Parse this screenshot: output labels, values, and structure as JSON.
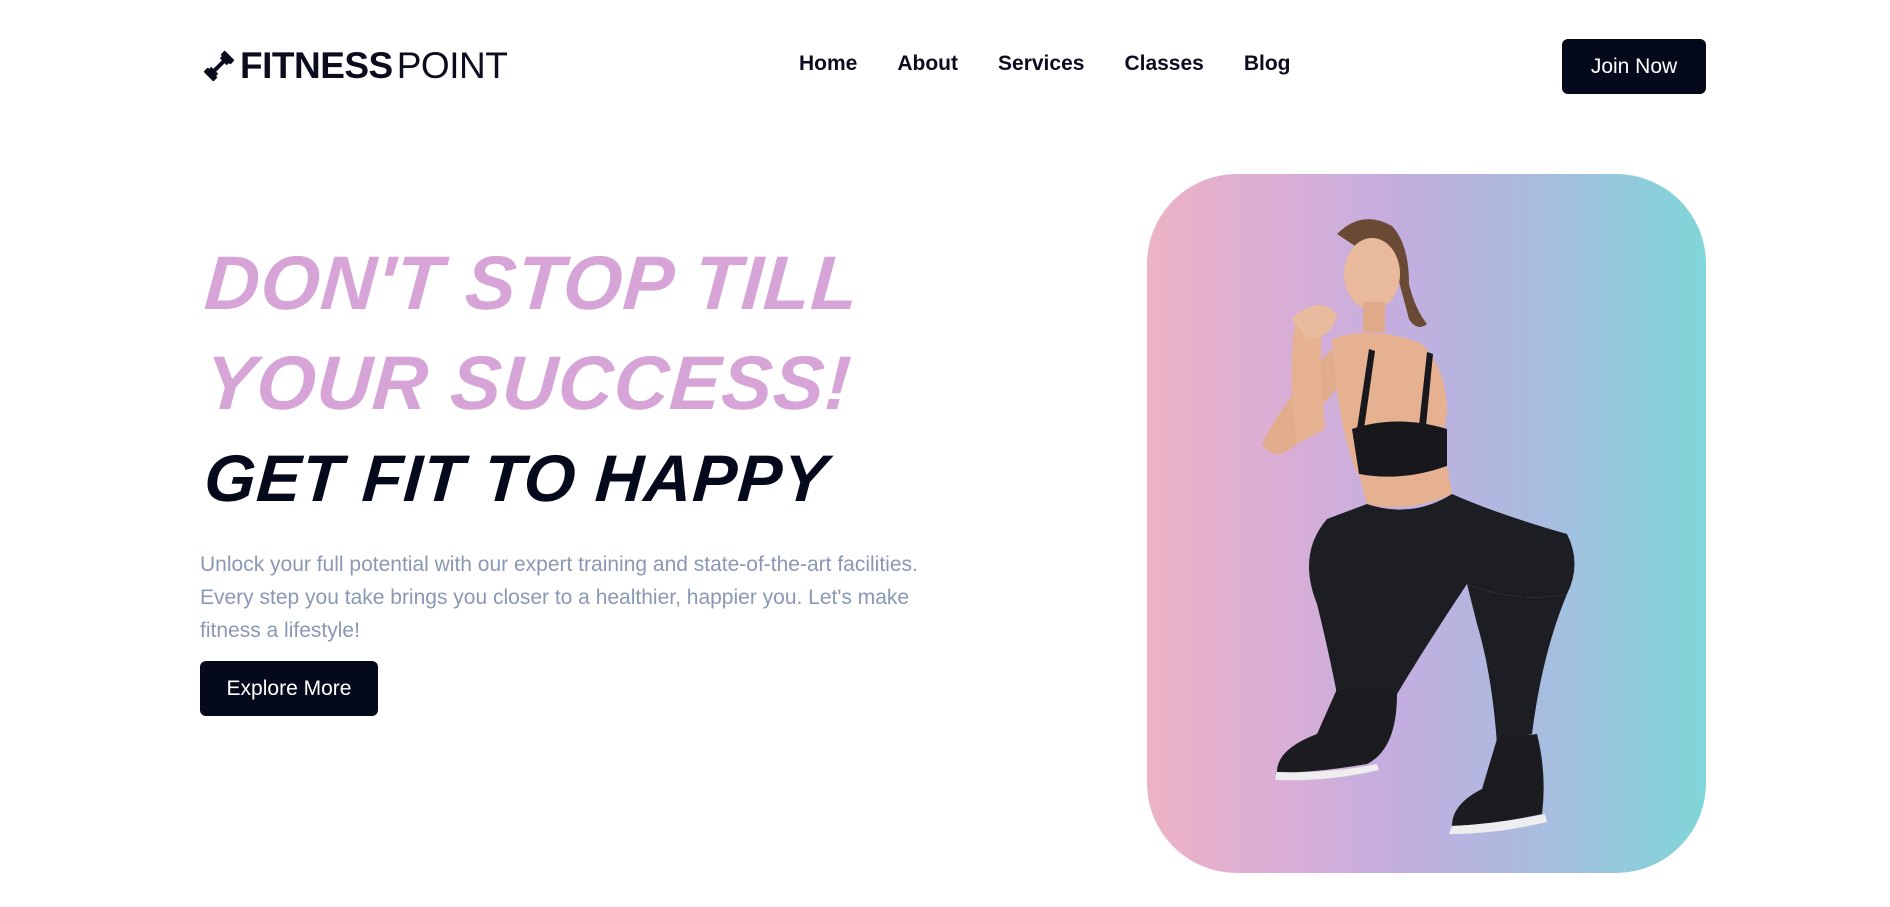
{
  "brand": {
    "name_bold": "FITNESS",
    "name_light": "POINT"
  },
  "nav": {
    "links": [
      "Home",
      "About",
      "Services",
      "Classes",
      "Blog"
    ],
    "cta": "Join Now"
  },
  "hero": {
    "headline_line1": "DON'T STOP TILL",
    "headline_line2": "YOUR SUCCESS!",
    "headline_line3": "GET FIT TO HAPPY",
    "description": "Unlock your full potential with our expert training and state-of-the-art facilities. Every step you take brings you closer to a healthier, happier you. Let's make fitness a lifestyle!",
    "button": "Explore More"
  },
  "colors": {
    "accent_pink": "#d6a4d6",
    "dark": "#05091c",
    "muted_text": "#8a98b4",
    "gradient_start": "#edb2c5",
    "gradient_mid": "#c3aee0",
    "gradient_end": "#7fd6d8"
  },
  "icons": {
    "logo": "dumbbell-icon"
  }
}
